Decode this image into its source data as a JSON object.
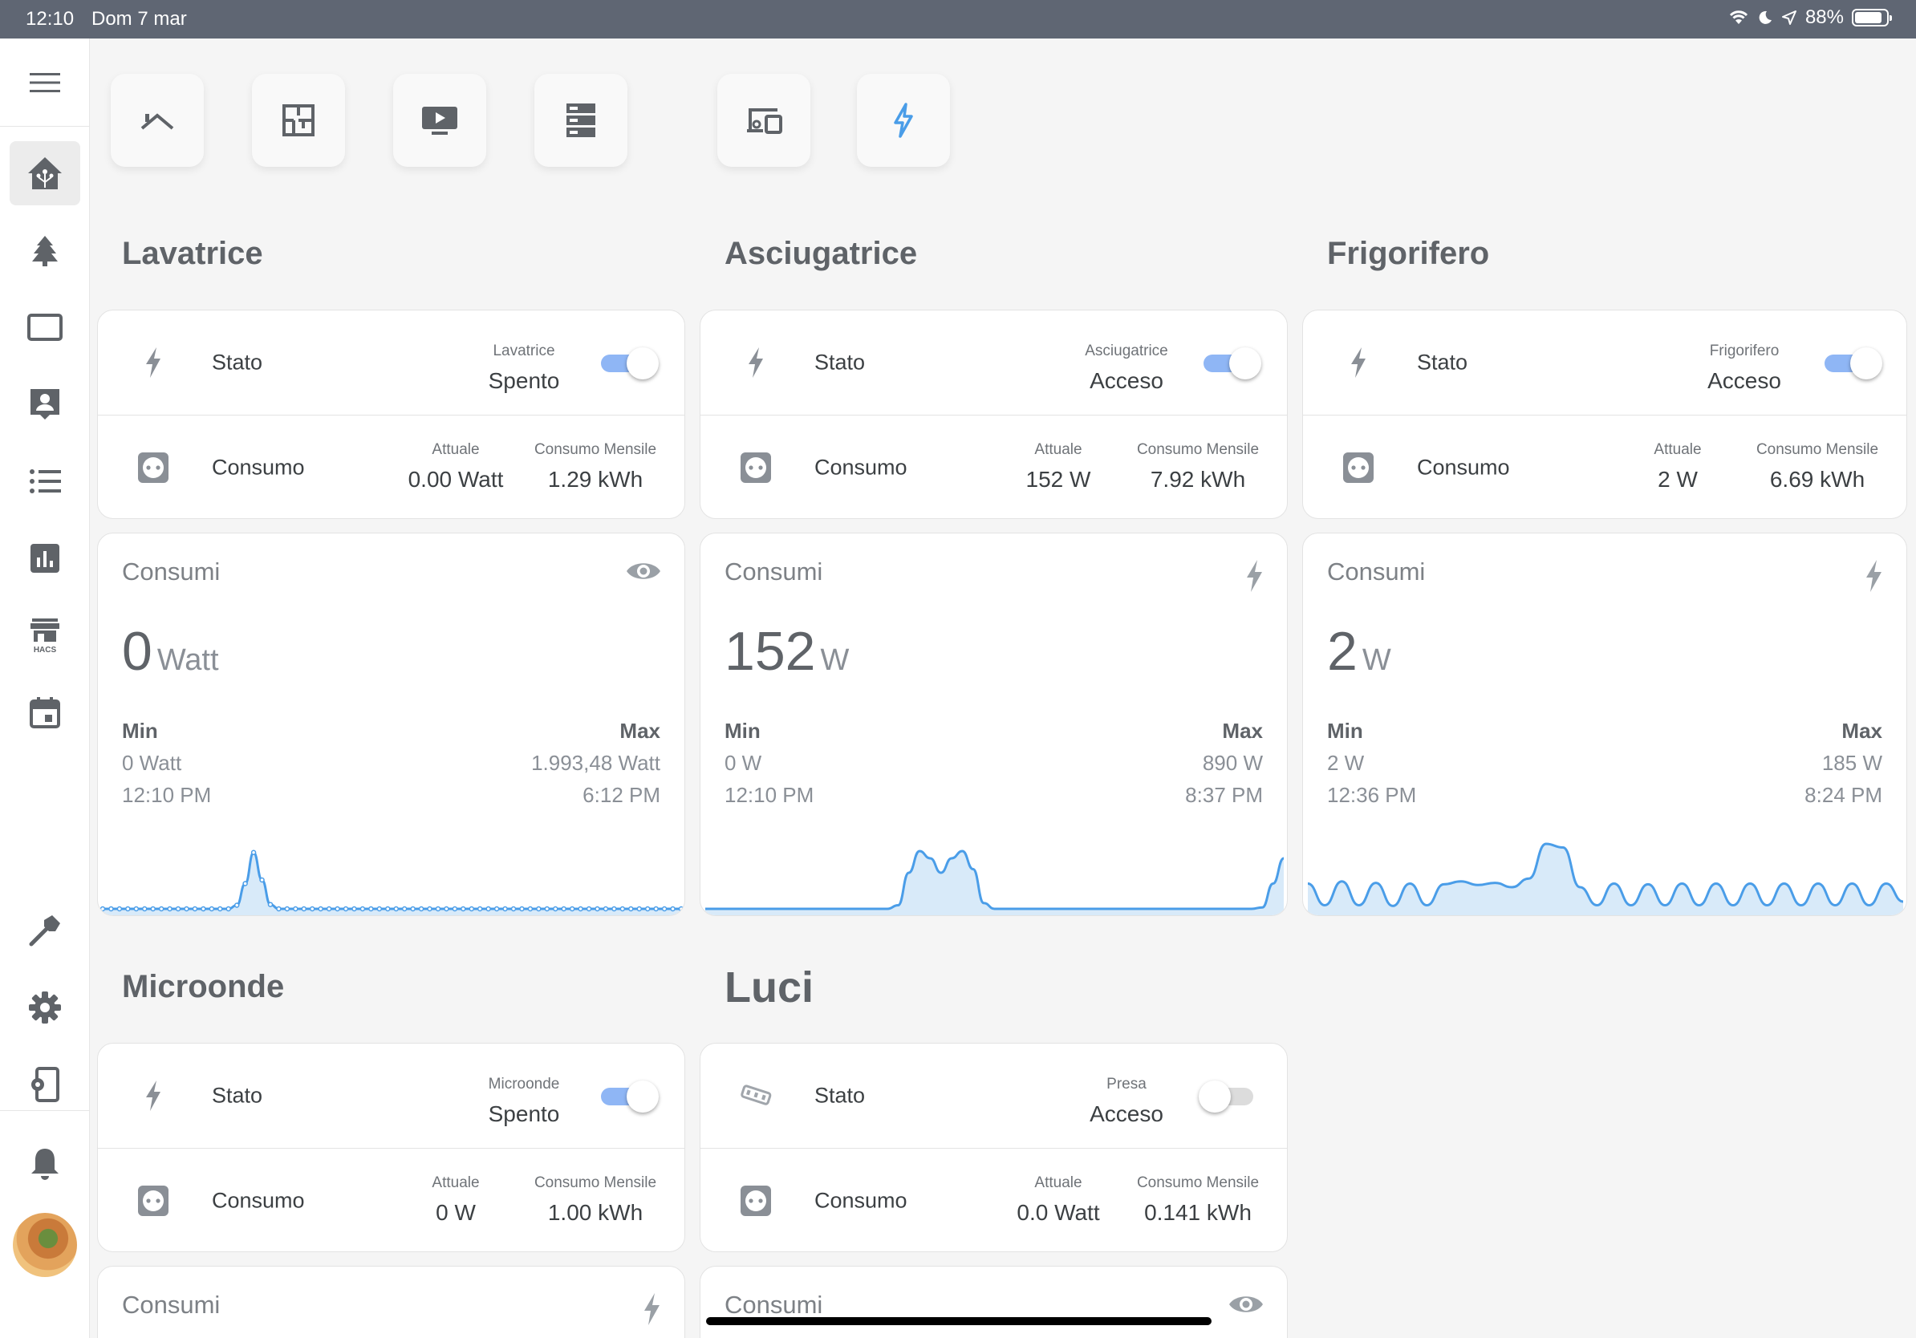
{
  "status_bar": {
    "time": "12:10",
    "date": "Dom 7 mar",
    "battery": "88%",
    "battery_level": 0.88
  },
  "sidebar": {
    "icons": [
      "menu-icon",
      "home-assistant-icon",
      "pine-tree-icon",
      "tablet-icon",
      "account-box-icon",
      "format-list-icon",
      "chart-box-icon",
      "hacs-store-icon",
      "calendar-icon",
      "hammer-icon",
      "cog-icon",
      "cellphone-cog-icon",
      "bell-icon"
    ],
    "hacs_label": "HACS"
  },
  "tabs": [
    "roof-icon",
    "floor-plan-icon",
    "television-play-icon",
    "server-icon",
    "devices-icon",
    "flash-icon"
  ],
  "colors": {
    "accent": "#4a9de8",
    "spark_fill": "#d8eaf9",
    "toggle_on": "#8fb6f5"
  },
  "sections": [
    {
      "title": "Lavatrice",
      "stato_label": "Stato",
      "stato_caption": "Lavatrice",
      "stato_value": "Spento",
      "toggle_on": true,
      "consumo_label": "Consumo",
      "attuale_caption": "Attuale",
      "attuale_value": "0.00 Watt",
      "mensile_caption": "Consumo Mensile",
      "mensile_value": "1.29 kWh",
      "graph": {
        "title": "Consumi",
        "icon": "eye-icon",
        "value": "0",
        "unit": "Watt",
        "min_label": "Min",
        "min_value": "0 Watt",
        "min_time": "12:10 PM",
        "max_label": "Max",
        "max_value": "1.993,48 Watt",
        "max_time": "6:12 PM",
        "series": [
          0,
          0,
          0,
          0,
          0,
          0,
          0,
          0,
          0,
          0,
          0,
          0,
          0,
          0,
          0,
          0,
          0.05,
          0.35,
          0.78,
          0.4,
          0.06,
          0,
          0,
          0,
          0,
          0,
          0,
          0,
          0,
          0,
          0,
          0,
          0,
          0,
          0,
          0,
          0,
          0,
          0,
          0,
          0,
          0,
          0,
          0,
          0,
          0,
          0,
          0,
          0,
          0,
          0,
          0,
          0,
          0,
          0,
          0,
          0,
          0,
          0,
          0,
          0,
          0,
          0,
          0,
          0,
          0,
          0,
          0,
          0,
          0
        ]
      }
    },
    {
      "title": "Asciugatrice",
      "stato_label": "Stato",
      "stato_caption": "Asciugatrice",
      "stato_value": "Acceso",
      "toggle_on": true,
      "consumo_label": "Consumo",
      "attuale_caption": "Attuale",
      "attuale_value": "152 W",
      "mensile_caption": "Consumo Mensile",
      "mensile_value": "7.92 kWh",
      "graph": {
        "title": "Consumi",
        "icon": "flash-icon",
        "value": "152",
        "unit": "W",
        "min_label": "Min",
        "min_value": "0 W",
        "min_time": "12:10 PM",
        "max_label": "Max",
        "max_value": "890 W",
        "max_time": "8:37 PM",
        "series": [
          0,
          0,
          0,
          0,
          0,
          0,
          0,
          0,
          0,
          0,
          0,
          0,
          0,
          0,
          0,
          0,
          0,
          0,
          0.05,
          0.5,
          0.8,
          0.7,
          0.5,
          0.7,
          0.8,
          0.55,
          0.08,
          0,
          0,
          0,
          0,
          0,
          0,
          0,
          0,
          0,
          0,
          0,
          0,
          0,
          0,
          0,
          0,
          0,
          0,
          0,
          0,
          0,
          0,
          0,
          0,
          0,
          0.02,
          0.35,
          0.7
        ]
      }
    },
    {
      "title": "Frigorifero",
      "stato_label": "Stato",
      "stato_caption": "Frigorifero",
      "stato_value": "Acceso",
      "toggle_on": true,
      "consumo_label": "Consumo",
      "attuale_caption": "Attuale",
      "attuale_value": "2 W",
      "mensile_caption": "Consumo Mensile",
      "mensile_value": "6.69 kWh",
      "graph": {
        "title": "Consumi",
        "icon": "flash-icon",
        "value": "2",
        "unit": "W",
        "min_label": "Min",
        "min_value": "2 W",
        "min_time": "12:36 PM",
        "max_label": "Max",
        "max_value": "185 W",
        "max_time": "8:24 PM",
        "series": [
          0.35,
          0.05,
          0.38,
          0.05,
          0.36,
          0.04,
          0.35,
          0.05,
          0.34,
          0.38,
          0.33,
          0.36,
          0.3,
          0.42,
          0.9,
          0.85,
          0.3,
          0.05,
          0.35,
          0.05,
          0.34,
          0.05,
          0.35,
          0.05,
          0.35,
          0.05,
          0.35,
          0.05,
          0.35,
          0.05,
          0.35,
          0.05,
          0.35,
          0.05,
          0.35,
          0.1
        ]
      }
    },
    {
      "title": "Microonde",
      "stato_label": "Stato",
      "stato_caption": "Microonde",
      "stato_value": "Spento",
      "toggle_on": true,
      "consumo_label": "Consumo",
      "attuale_caption": "Attuale",
      "attuale_value": "0 W",
      "mensile_caption": "Consumo Mensile",
      "mensile_value": "1.00 kWh",
      "graph": {
        "title": "Consumi",
        "icon": "flash-icon"
      }
    },
    {
      "title": "Luci",
      "stato_label": "Stato",
      "stato_caption": "Presa",
      "stato_value": "Acceso",
      "toggle_on": false,
      "consumo_label": "Consumo",
      "attuale_caption": "Attuale",
      "attuale_value": "0.0 Watt",
      "mensile_caption": "Consumo Mensile",
      "mensile_value": "0.141 kWh",
      "graph": {
        "title": "Consumi",
        "icon": "eye-icon"
      }
    }
  ]
}
